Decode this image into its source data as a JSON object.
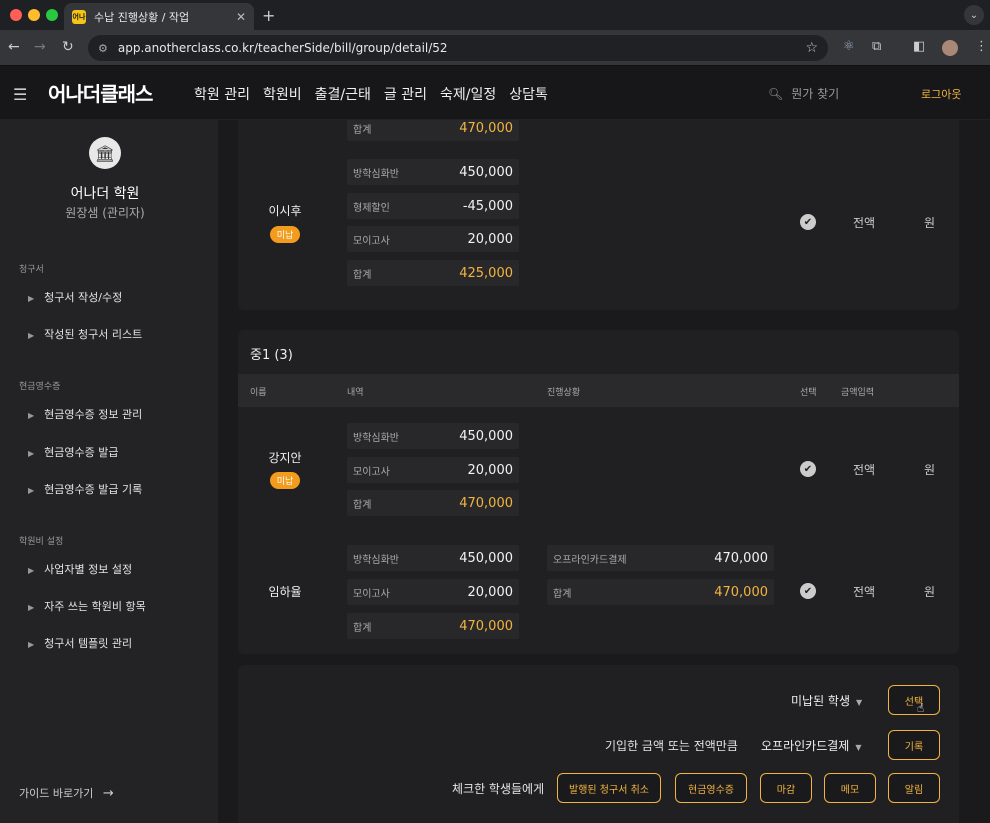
{
  "browser": {
    "tab_title": "수납 진행상황 / 작업",
    "favicon_text": "어나",
    "url": "app.anotherclass.co.kr/teacherSide/bill/group/detail/52"
  },
  "header": {
    "logo": "어나더클래스",
    "menu": [
      "학원 관리",
      "학원비",
      "출결/근태",
      "글 관리",
      "숙제/일정",
      "상담톡"
    ],
    "search_placeholder": "뭔가 찾기",
    "logout": "로그아웃"
  },
  "sidebar": {
    "academy": "어나더 학원",
    "role": "원장샘 (관리자)",
    "sections": [
      {
        "title": "청구서",
        "items": [
          "청구서 작성/수정",
          "작성된 청구서 리스트"
        ]
      },
      {
        "title": "현금영수증",
        "items": [
          "현금영수증 정보 관리",
          "현금영수증 발급",
          "현금영수증 발급 기록"
        ]
      },
      {
        "title": "학원비 설정",
        "items": [
          "사업자별 정보 설정",
          "자주 쓰는 학원비 항목",
          "청구서 템플릿 관리"
        ]
      }
    ],
    "guide": "가이드 바로가기"
  },
  "top_card": {
    "prev_total": {
      "label": "합계",
      "value": "470,000"
    },
    "student": {
      "name": "이시후",
      "badge": "미납",
      "items": [
        {
          "label": "방학심화반",
          "value": "450,000"
        },
        {
          "label": "형제할인",
          "value": "-45,000"
        },
        {
          "label": "모이고사",
          "value": "20,000"
        }
      ],
      "total": {
        "label": "합계",
        "value": "425,000"
      },
      "full": "전액",
      "won": "원"
    }
  },
  "group": {
    "title": "중1 (3)",
    "columns": [
      "이름",
      "내역",
      "진행상황",
      "선택",
      "금액입력"
    ],
    "students": [
      {
        "name": "강지안",
        "badge": "미납",
        "items": [
          {
            "label": "방학심화반",
            "value": "450,000"
          },
          {
            "label": "모이고사",
            "value": "20,000"
          }
        ],
        "total": {
          "label": "합계",
          "value": "470,000"
        },
        "full": "전액",
        "won": "원"
      },
      {
        "name": "임하율",
        "items": [
          {
            "label": "방학심화반",
            "value": "450,000"
          },
          {
            "label": "모이고사",
            "value": "20,000"
          }
        ],
        "total": {
          "label": "합계",
          "value": "470,000"
        },
        "progress": [
          {
            "label": "오프라인카드결제",
            "value": "470,000"
          },
          {
            "label": "합계",
            "value": "470,000"
          }
        ],
        "full": "전액",
        "won": "원"
      }
    ]
  },
  "actions": {
    "filter_select": "미납된 학생",
    "select_button": "선택",
    "record_label": "기입한 금액 또는 전액만큼",
    "payment_select": "오프라인카드결제",
    "record_button": "기록",
    "checked_label": "체크한 학생들에게",
    "buttons": [
      "발행된 청구서 취소",
      "현금영수증",
      "마감",
      "메모",
      "알림"
    ]
  },
  "colors": {
    "accent": "#f2b440",
    "badge": "#f39b1c"
  }
}
